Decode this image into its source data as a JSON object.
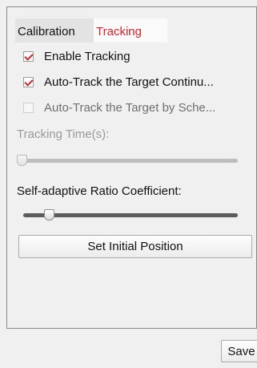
{
  "tabs": [
    {
      "label": "Calibration",
      "active": false
    },
    {
      "label": "Tracking",
      "active": true
    }
  ],
  "options": {
    "enable_tracking": {
      "label": "Enable Tracking",
      "checked": true
    },
    "auto_track_continuous": {
      "label": "Auto-Track the Target Continu...",
      "checked": true
    },
    "auto_track_schedule": {
      "label": "Auto-Track the Target by Sche...",
      "checked": false,
      "enabled": false
    }
  },
  "tracking_time": {
    "label": "Tracking Time(s):",
    "enabled": false,
    "value_fraction": 0.0
  },
  "ratio_coefficient": {
    "label": "Self-adaptive Ratio Coefficient:",
    "enabled": true,
    "value_fraction": 0.12
  },
  "buttons": {
    "set_initial_position": "Set Initial Position",
    "save": "Save"
  },
  "colors": {
    "active_tab_text": "#d6232d",
    "checkmark": "#d0262c"
  }
}
